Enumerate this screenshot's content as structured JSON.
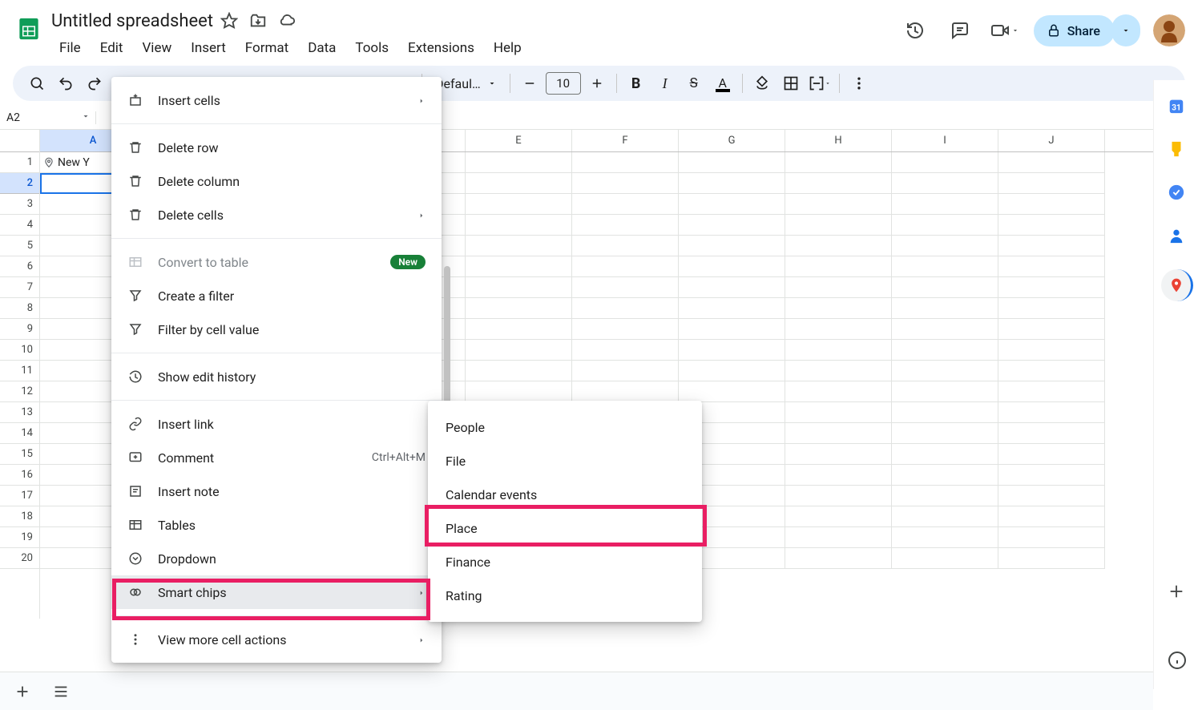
{
  "header": {
    "doc_title": "Untitled spreadsheet",
    "menus": {
      "file": "File",
      "edit": "Edit",
      "view": "View",
      "insert": "Insert",
      "format": "Format",
      "data": "Data",
      "tools": "Tools",
      "extensions": "Extensions",
      "help": "Help"
    },
    "share_label": "Share"
  },
  "toolbar": {
    "font_label": "Defaul…",
    "font_size": "10"
  },
  "namebox": {
    "value": "A2"
  },
  "columns": [
    "A",
    "E",
    "F",
    "G",
    "H",
    "I",
    "J"
  ],
  "rows": [
    "1",
    "2",
    "3",
    "4",
    "5",
    "6",
    "7",
    "8",
    "9",
    "10",
    "11",
    "12",
    "13",
    "14",
    "15",
    "16",
    "17",
    "18",
    "19",
    "20"
  ],
  "cells": {
    "a1_chip": "New Y"
  },
  "context_menu": {
    "insert_cells": "Insert cells",
    "delete_row": "Delete row",
    "delete_column": "Delete column",
    "delete_cells": "Delete cells",
    "convert_table": "Convert to table",
    "convert_badge": "New",
    "create_filter": "Create a filter",
    "filter_by_value": "Filter by cell value",
    "show_history": "Show edit history",
    "insert_link": "Insert link",
    "comment": "Comment",
    "comment_kbd": "Ctrl+Alt+M",
    "insert_note": "Insert note",
    "tables": "Tables",
    "dropdown": "Dropdown",
    "smart_chips": "Smart chips",
    "view_more": "View more cell actions"
  },
  "submenu": {
    "people": "People",
    "file": "File",
    "calendar": "Calendar events",
    "place": "Place",
    "finance": "Finance",
    "rating": "Rating"
  }
}
